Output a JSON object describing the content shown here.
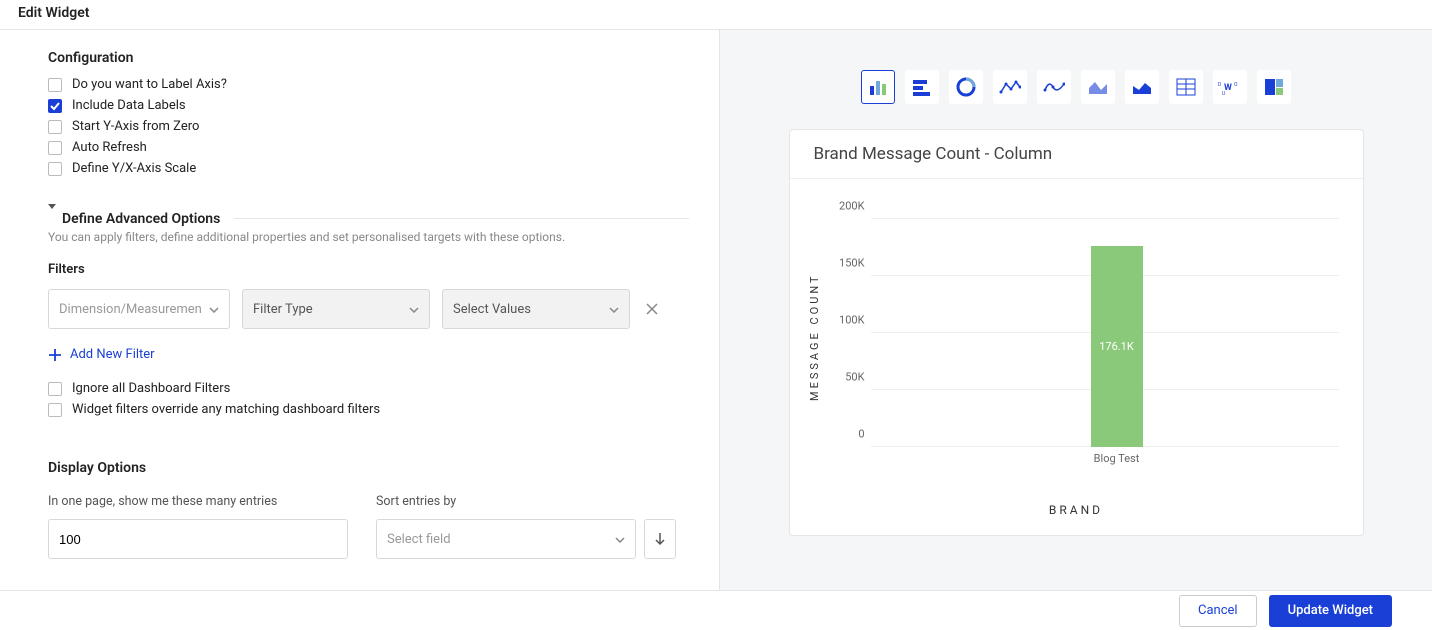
{
  "header": {
    "title": "Edit Widget"
  },
  "config": {
    "title": "Configuration",
    "items": [
      {
        "id": "label-axis",
        "label": "Do you want to Label Axis?",
        "checked": false
      },
      {
        "id": "data-labels",
        "label": "Include Data Labels",
        "checked": true
      },
      {
        "id": "y-zero",
        "label": "Start Y-Axis from Zero",
        "checked": false
      },
      {
        "id": "auto-refresh",
        "label": "Auto Refresh",
        "checked": false
      },
      {
        "id": "define-scale",
        "label": "Define Y/X-Axis Scale",
        "checked": false
      }
    ]
  },
  "advanced": {
    "title": "Define Advanced Options",
    "subtitle": "You can apply filters, define additional properties and set personalised targets with these options.",
    "filters_title": "Filters",
    "filter": {
      "dimension_placeholder": "Dimension/Measurement",
      "type_label": "Filter Type",
      "values_label": "Select Values"
    },
    "add_filter_label": "Add New Filter",
    "ignore_filters_label": "Ignore all Dashboard Filters",
    "override_filters_label": "Widget filters override any matching dashboard filters"
  },
  "display": {
    "title": "Display Options",
    "entries_label": "In one page, show me these many entries",
    "entries_value": "100",
    "sort_label": "Sort entries by",
    "sort_placeholder": "Select field"
  },
  "right": {
    "chart_types": [
      {
        "id": "column",
        "icon": "column-chart-icon",
        "active": true
      },
      {
        "id": "bar",
        "icon": "bar-chart-icon",
        "active": false
      },
      {
        "id": "donut",
        "icon": "donut-chart-icon",
        "active": false
      },
      {
        "id": "line",
        "icon": "line-chart-icon",
        "active": false
      },
      {
        "id": "spline",
        "icon": "spline-chart-icon",
        "active": false
      },
      {
        "id": "area",
        "icon": "area-chart-icon",
        "active": false
      },
      {
        "id": "area-filled",
        "icon": "area-filled-chart-icon",
        "active": false
      },
      {
        "id": "table",
        "icon": "table-chart-icon",
        "active": false
      },
      {
        "id": "wordcloud",
        "icon": "wordcloud-chart-icon",
        "active": false
      },
      {
        "id": "treemap",
        "icon": "treemap-chart-icon",
        "active": false
      }
    ],
    "chart_title": "Brand Message Count - Column"
  },
  "chart_data": {
    "type": "bar",
    "title": "Brand Message Count - Column",
    "xlabel": "BRAND",
    "ylabel": "MESSAGE COUNT",
    "ylim": [
      0,
      200000
    ],
    "yticks": [
      "0",
      "50K",
      "100K",
      "150K",
      "200K"
    ],
    "categories": [
      "Blog Test"
    ],
    "values": [
      176100
    ],
    "data_labels": [
      "176.1K"
    ],
    "series_color": "#8bc97a"
  },
  "footer": {
    "cancel_label": "Cancel",
    "update_label": "Update Widget"
  }
}
